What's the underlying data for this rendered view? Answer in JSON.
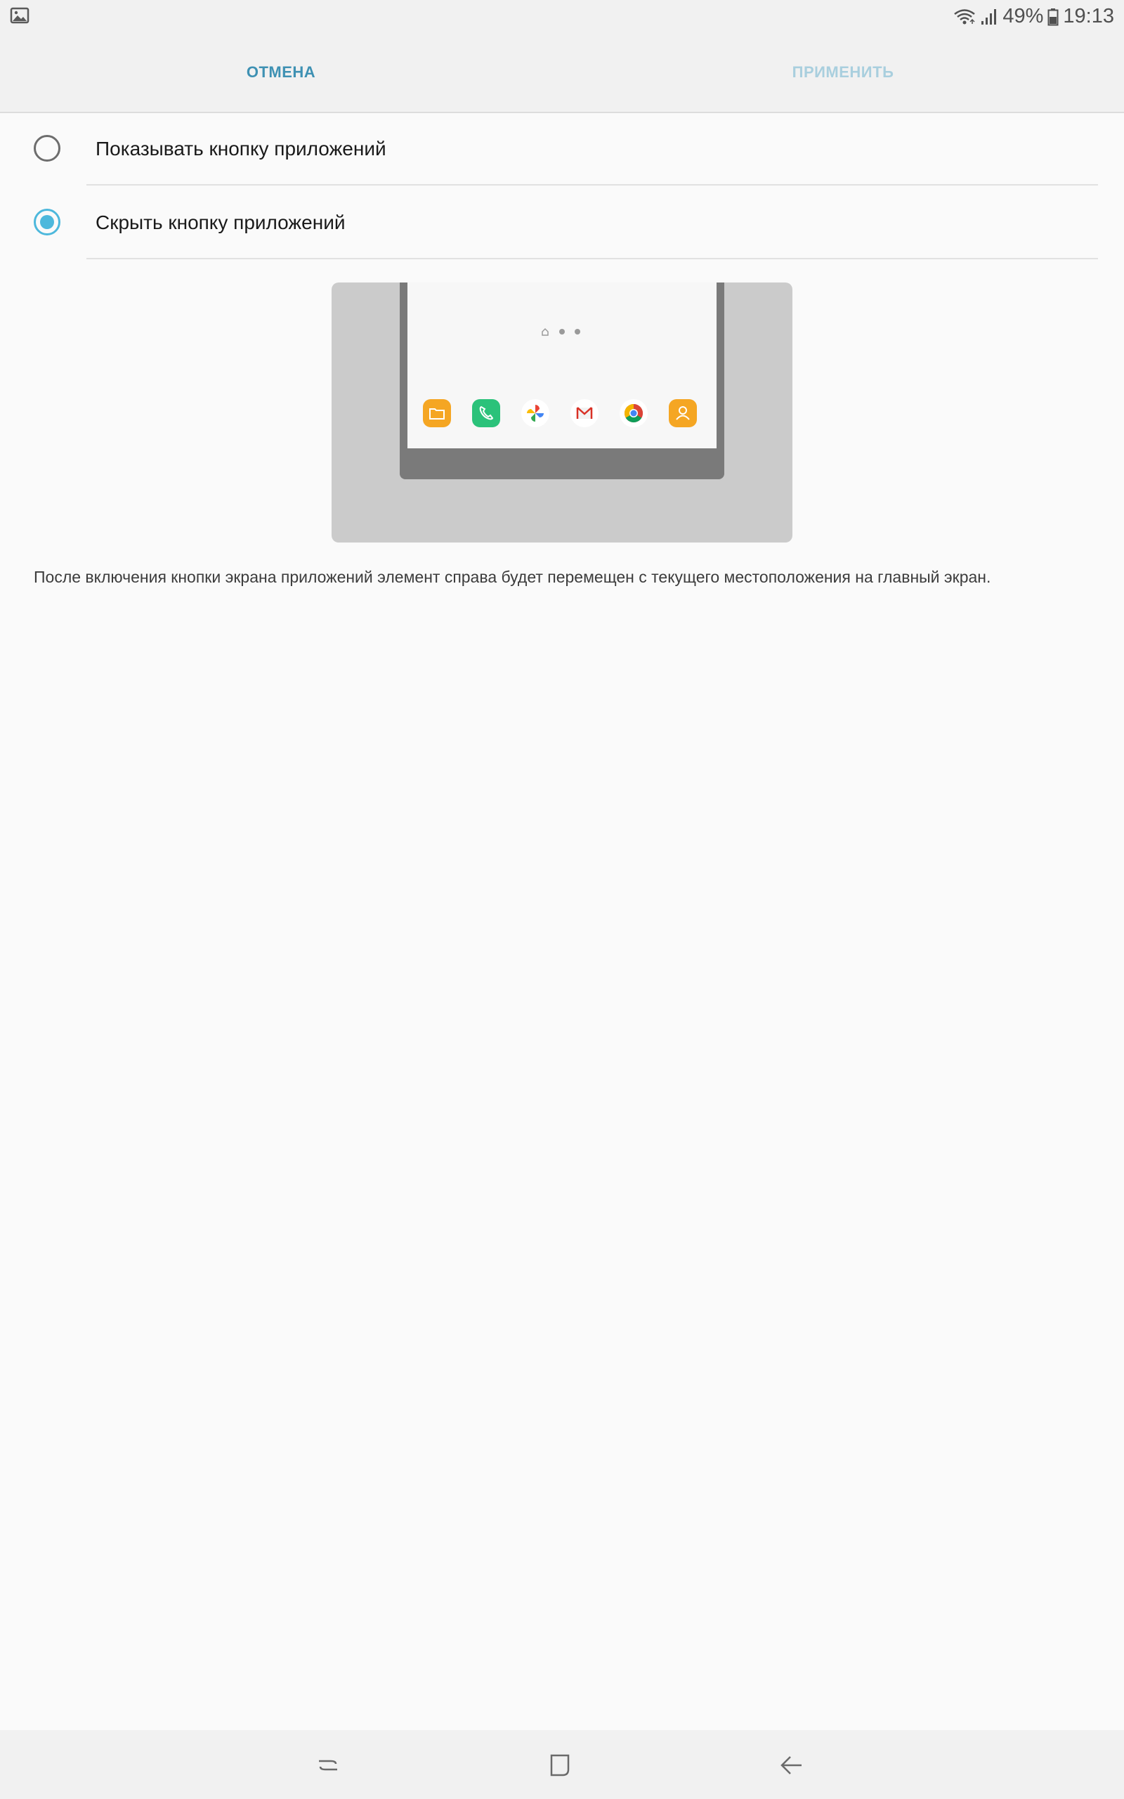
{
  "status_bar": {
    "battery_percent": "49%",
    "time": "19:13"
  },
  "action_bar": {
    "cancel_label": "ОТМЕНА",
    "apply_label": "ПРИМЕНИТЬ"
  },
  "options": [
    {
      "label": "Показывать кнопку приложений",
      "selected": false
    },
    {
      "label": "Скрыть кнопку приложений",
      "selected": true
    }
  ],
  "description": "После включения кнопки экрана приложений элемент справа будет перемещен с текущего местоположения на главный экран.",
  "illustration": {
    "dock_apps": [
      "folder-icon",
      "phone-icon",
      "photos-icon",
      "gmail-icon",
      "chrome-icon",
      "contacts-icon"
    ]
  },
  "colors": {
    "accent": "#4db8dc",
    "cancel_text": "#3e91b3",
    "apply_text_disabled": "#a9cfde"
  }
}
